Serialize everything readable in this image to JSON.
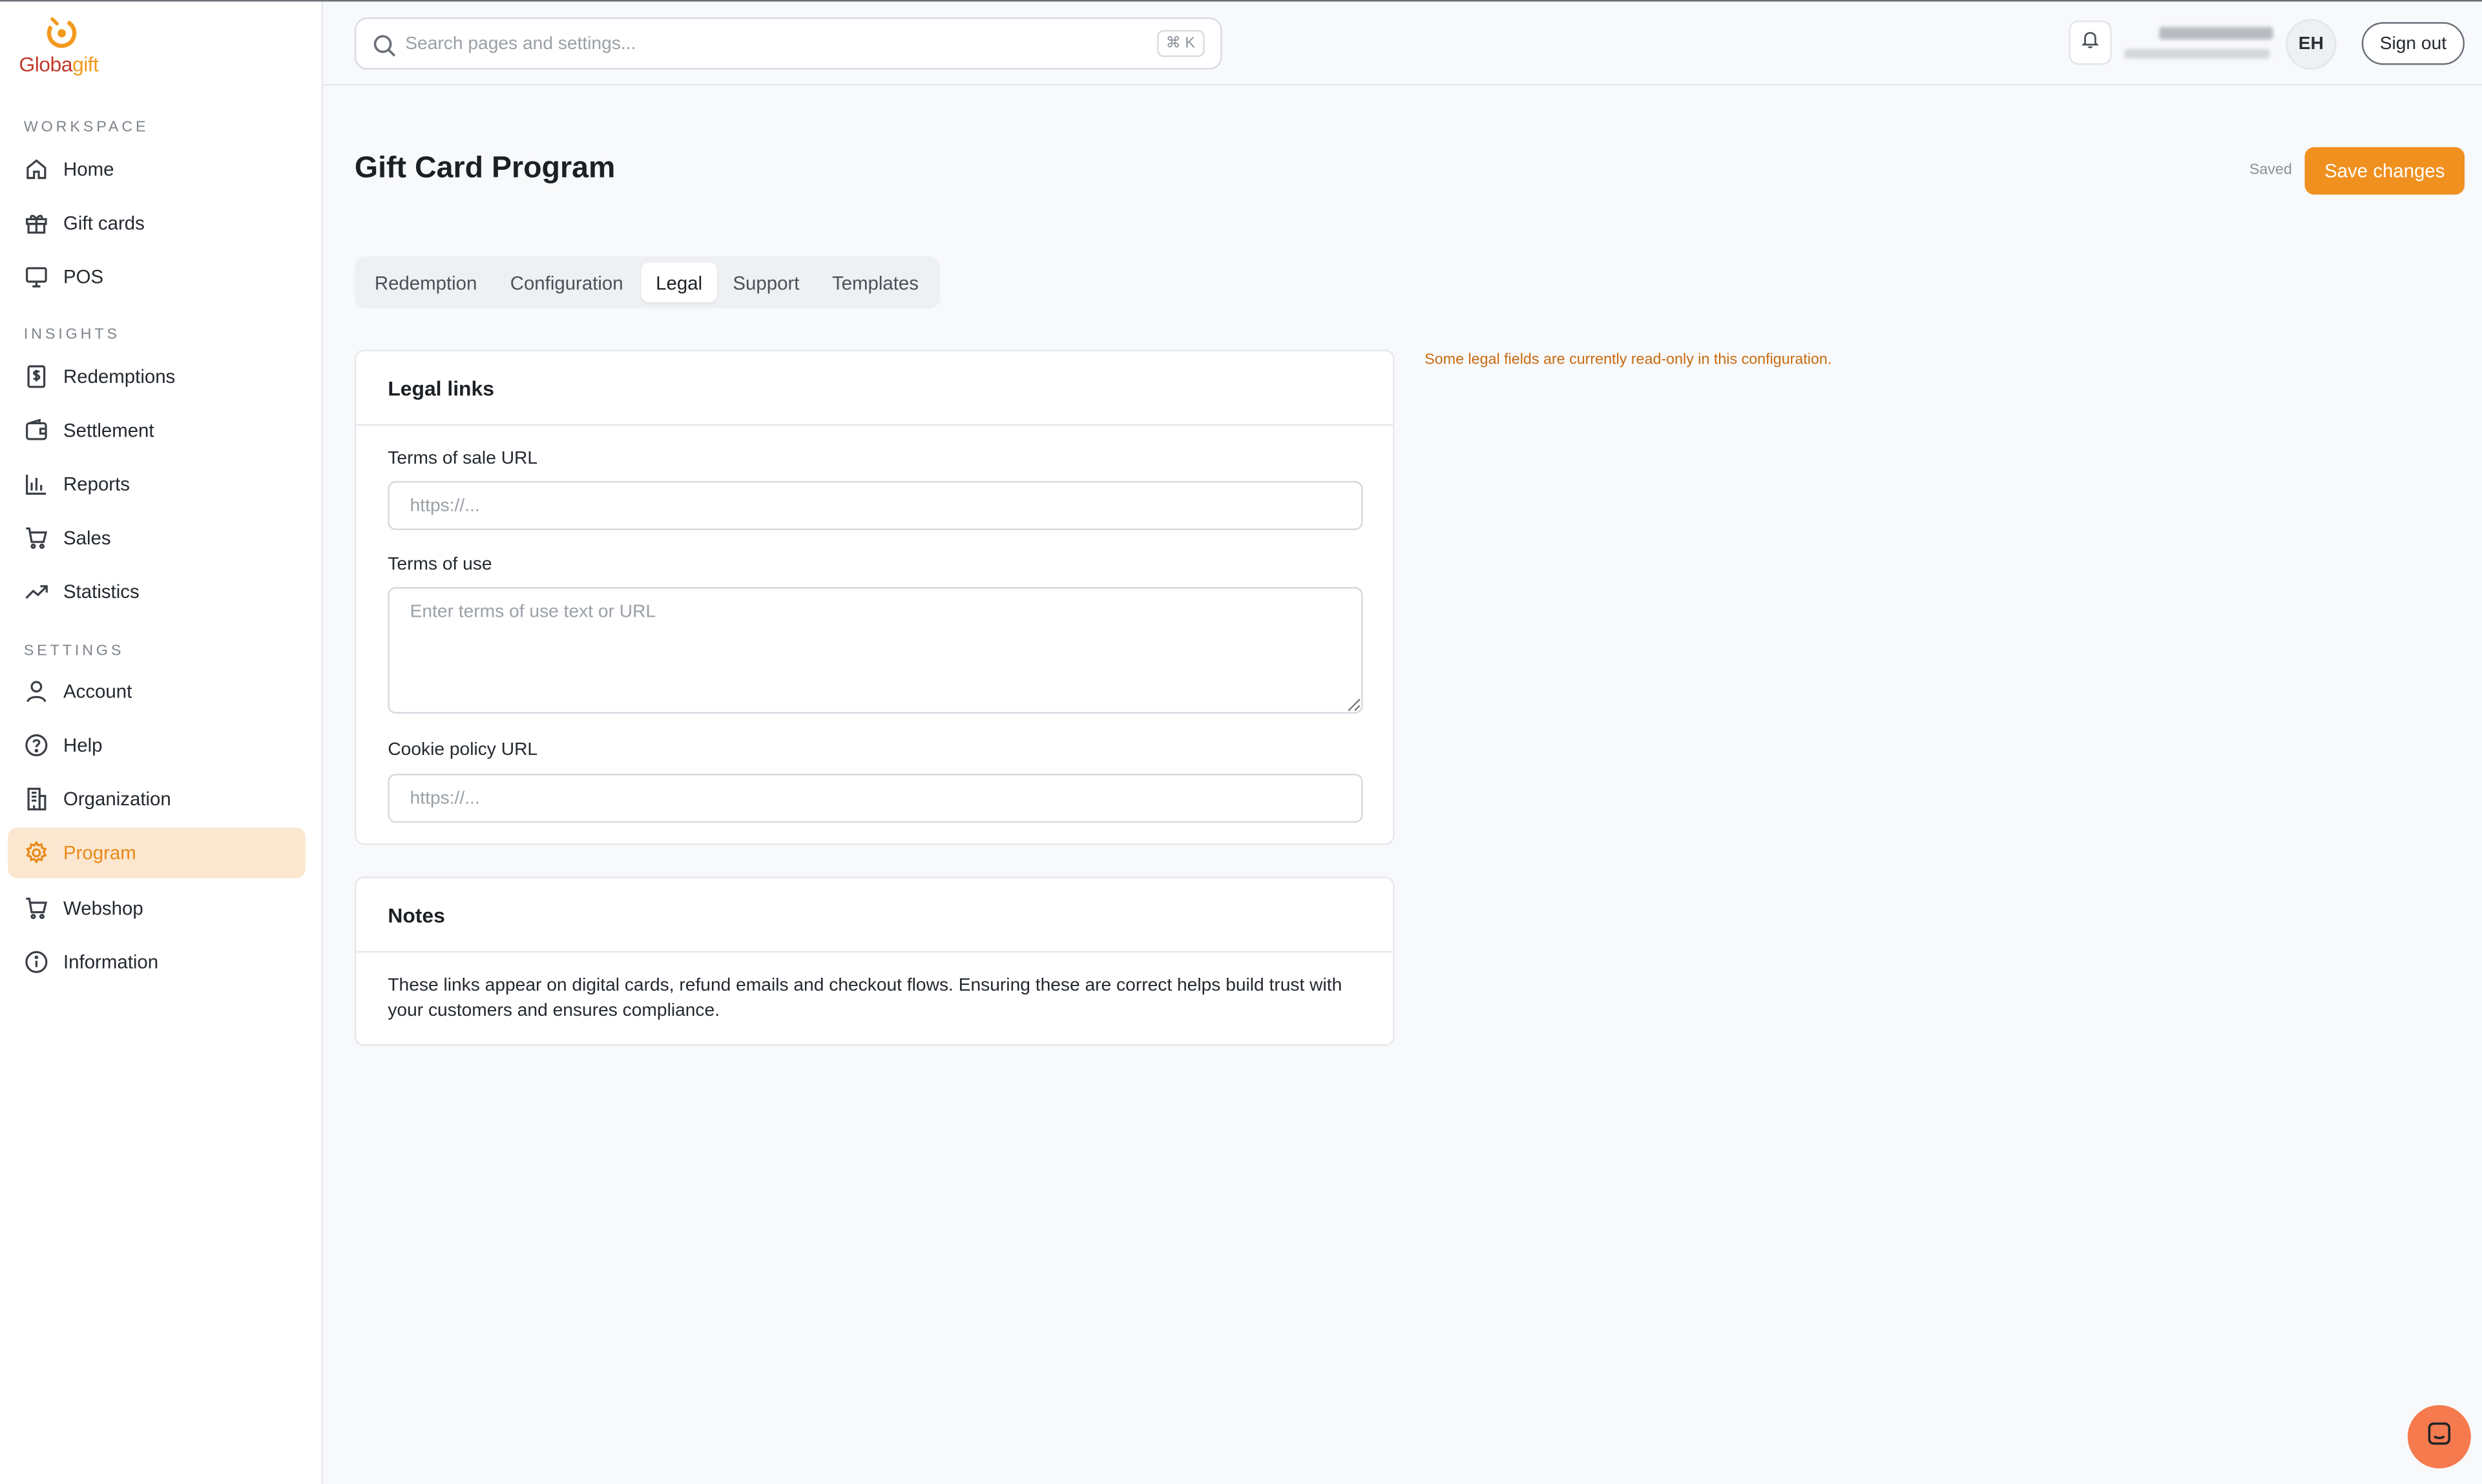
{
  "brand": {
    "part1": "Globa",
    "part2": "gift",
    "color_primary": "#f29a1f",
    "color_secondary": "#c0392b"
  },
  "sidebar": {
    "sections": [
      {
        "label": "WORKSPACE",
        "items": [
          {
            "label": "Home",
            "icon": "home-icon"
          },
          {
            "label": "Gift cards",
            "icon": "gift-icon"
          },
          {
            "label": "POS",
            "icon": "monitor-icon"
          }
        ]
      },
      {
        "label": "INSIGHTS",
        "items": [
          {
            "label": "Redemptions",
            "icon": "receipt-dollar-icon"
          },
          {
            "label": "Settlement",
            "icon": "wallet-icon"
          },
          {
            "label": "Reports",
            "icon": "bar-chart-icon"
          },
          {
            "label": "Sales",
            "icon": "cart-icon"
          },
          {
            "label": "Statistics",
            "icon": "trending-up-icon"
          }
        ]
      },
      {
        "label": "SETTINGS",
        "items": [
          {
            "label": "Account",
            "icon": "user-icon"
          },
          {
            "label": "Help",
            "icon": "help-circle-icon"
          },
          {
            "label": "Organization",
            "icon": "building-icon"
          },
          {
            "label": "Program",
            "icon": "gear-icon",
            "active": true
          },
          {
            "label": "Webshop",
            "icon": "cart-icon"
          },
          {
            "label": "Information",
            "icon": "info-icon"
          }
        ]
      }
    ],
    "active_color": "#e8891a"
  },
  "header": {
    "search_placeholder": "Search pages and settings...",
    "search_shortcut": "⌘ K",
    "avatar_initials": "EH",
    "sign_out_label": "Sign out"
  },
  "page": {
    "title": "Gift Card Program",
    "saved_status": "Saved",
    "save_button": "Save changes",
    "tabs": [
      "Redemption",
      "Configuration",
      "Legal",
      "Support",
      "Templates"
    ],
    "active_tab": "Legal",
    "warning": "Some legal fields are currently read-only in this configuration.",
    "legal_card": {
      "title": "Legal links",
      "fields": [
        {
          "label": "Terms of sale URL",
          "placeholder": "https://...",
          "value": ""
        },
        {
          "label": "Terms of use",
          "placeholder": "Enter terms of use text or URL",
          "value": ""
        },
        {
          "label": "Cookie policy URL",
          "placeholder": "https://...",
          "value": ""
        }
      ]
    },
    "notes_card": {
      "title": "Notes",
      "text": "These links appear on digital cards, refund emails and checkout flows. Ensuring these are correct helps build trust with your customers and ensures compliance."
    }
  },
  "colors": {
    "accent": "#f0901f",
    "warning": "#c76a10",
    "chat": "#f57a4e"
  }
}
